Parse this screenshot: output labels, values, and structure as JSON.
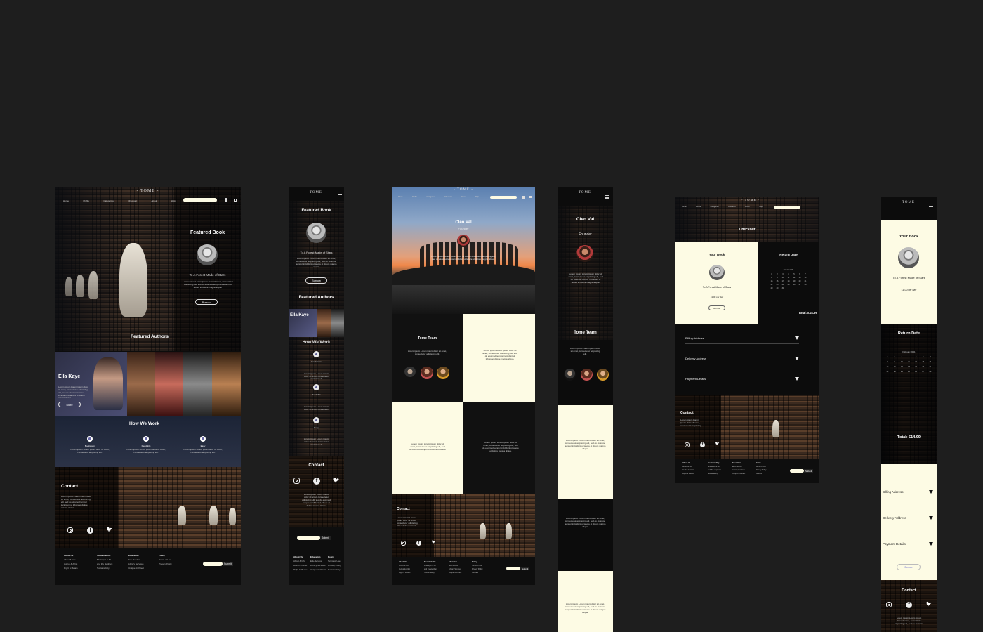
{
  "brand": {
    "logo": "- TOME -"
  },
  "nav": [
    "Home",
    "Profile",
    "Categories",
    "Checkout",
    "About",
    "Help"
  ],
  "home": {
    "featured_book_heading": "Featured Book",
    "book_title": "To A Forest Made of Stars",
    "borrow": "Borrow",
    "featured_authors": "Featured Authors",
    "author_name": "Ella Kaye",
    "more": "More",
    "how_we_work": "How We Work",
    "steps": [
      "Bookworm",
      "Readable",
      "Easy"
    ],
    "contact": "Contact",
    "lorem_short": "Lorem ipsum Lorem ipsum dolor sit amet, consectetur adipiscing elit, sed do eiusmod tempor incididunt ut labore et dolore magna aliqua.",
    "lorem_tiny": "Lorem ipsum Lorem ipsum dolor sit amet, consectetur adipiscing elit."
  },
  "footer": {
    "cols": [
      {
        "title": "About Us",
        "items": [
          "About & Info",
          "Author & Artist",
          "Right & Means"
        ]
      },
      {
        "title": "Sustainability",
        "items": [
          "Bhalarpur & Ari",
          "and the elephant",
          "Sustainability"
        ]
      },
      {
        "title": "Education",
        "items": [
          "Edu-Service",
          "Library Services",
          "Unique Architect"
        ]
      },
      {
        "title": "Policy",
        "items": [
          "Terms of Use",
          "Privacy Policy",
          "Cookies"
        ]
      }
    ],
    "submit": "Submit"
  },
  "mobile_footer_cols": [
    "About Us",
    "Education",
    "Policy",
    "Sustainability",
    "Right & Means",
    "Unique Architect",
    "Sustainability"
  ],
  "about": {
    "name": "Cleo Val",
    "role": "Founder",
    "team": "Tome Team"
  },
  "checkout": {
    "title": "Checkout",
    "your_book": "Your Book",
    "book_title": "To A Forest Made of Stars",
    "price": "£1.00 per day",
    "borrow": "Borrow",
    "return_date": "Return Date",
    "month": "January 2021",
    "total": "Total: £14.99",
    "month_mobile": "February 2021",
    "billing": "Billing Address",
    "delivery": "Delivery Address",
    "payment": "Payment Details",
    "contact": "Contact"
  }
}
